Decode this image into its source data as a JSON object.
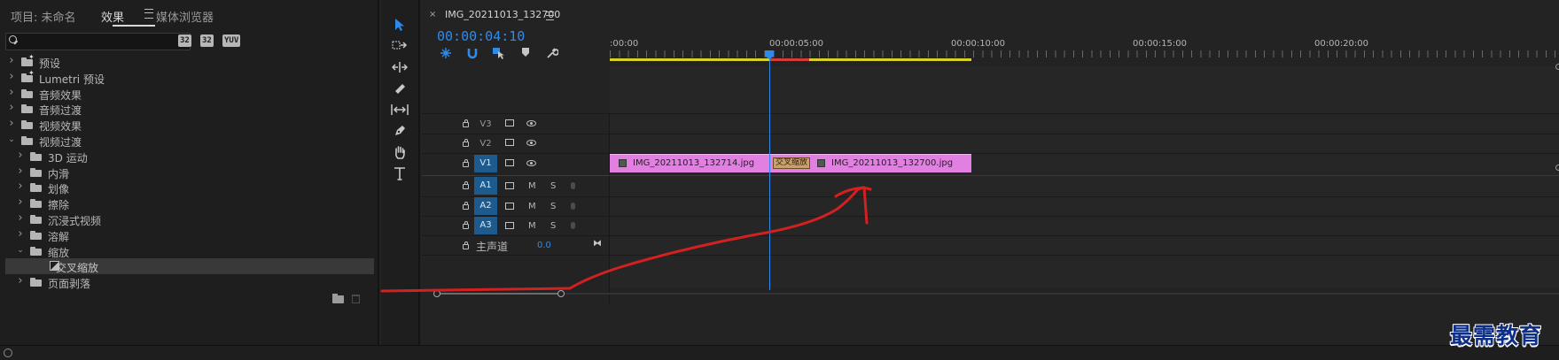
{
  "effects_panel": {
    "tabs": [
      {
        "label": "项目: 未命名"
      },
      {
        "label": "效果"
      },
      {
        "label": "媒体浏览器"
      }
    ],
    "search": {
      "placeholder": "",
      "value": ""
    },
    "filters": [
      "32",
      "32",
      "YUV"
    ],
    "tree": [
      {
        "label": "预设",
        "level": 0,
        "expanded": false,
        "special": true
      },
      {
        "label": "Lumetri 预设",
        "level": 0,
        "expanded": false,
        "special": true
      },
      {
        "label": "音频效果",
        "level": 0,
        "expanded": false
      },
      {
        "label": "音频过渡",
        "level": 0,
        "expanded": false
      },
      {
        "label": "视频效果",
        "level": 0,
        "expanded": false
      },
      {
        "label": "视频过渡",
        "level": 0,
        "expanded": true
      },
      {
        "label": "3D 运动",
        "level": 1,
        "expanded": false
      },
      {
        "label": "内滑",
        "level": 1,
        "expanded": false
      },
      {
        "label": "划像",
        "level": 1,
        "expanded": false
      },
      {
        "label": "擦除",
        "level": 1,
        "expanded": false
      },
      {
        "label": "沉浸式视频",
        "level": 1,
        "expanded": false
      },
      {
        "label": "溶解",
        "level": 1,
        "expanded": false
      },
      {
        "label": "缩放",
        "level": 1,
        "expanded": true
      },
      {
        "label": "交叉缩放",
        "level": 2,
        "effect": true,
        "selected": true
      },
      {
        "label": "页面剥落",
        "level": 1,
        "expanded": false
      }
    ]
  },
  "tools": [
    "selection-tool",
    "track-select-tool",
    "ripple-edit-tool",
    "razor-tool",
    "slip-tool",
    "pen-tool",
    "hand-tool",
    "type-tool"
  ],
  "timeline": {
    "sequence_tab": "IMG_20211013_132700",
    "close_glyph": "×",
    "timecode": "00:00:04:10",
    "ruler_labels": [
      ":00:00",
      "00:00:05:00",
      "00:00:10:00",
      "00:00:15:00",
      "00:00:20:00"
    ],
    "video_tracks": [
      "V3",
      "V2",
      "V1"
    ],
    "audio_tracks": [
      "A1",
      "A2",
      "A3"
    ],
    "audio_buttons": {
      "mute": "M",
      "solo": "S"
    },
    "master": {
      "label": "主声道",
      "value": "0.0"
    },
    "clips": [
      {
        "name": "IMG_20211013_132714.jpg"
      },
      {
        "name": "IMG_20211013_132700.jpg"
      }
    ],
    "transition_label": "交叉缩放",
    "playhead_fraction": 0.222
  },
  "watermark": "最需教育",
  "colors": {
    "accent": "#2d8ceb",
    "clip": "#e27fe2",
    "transition": "#c9a06a",
    "annotation": "#d42020",
    "workarea": "#d7d22a"
  }
}
